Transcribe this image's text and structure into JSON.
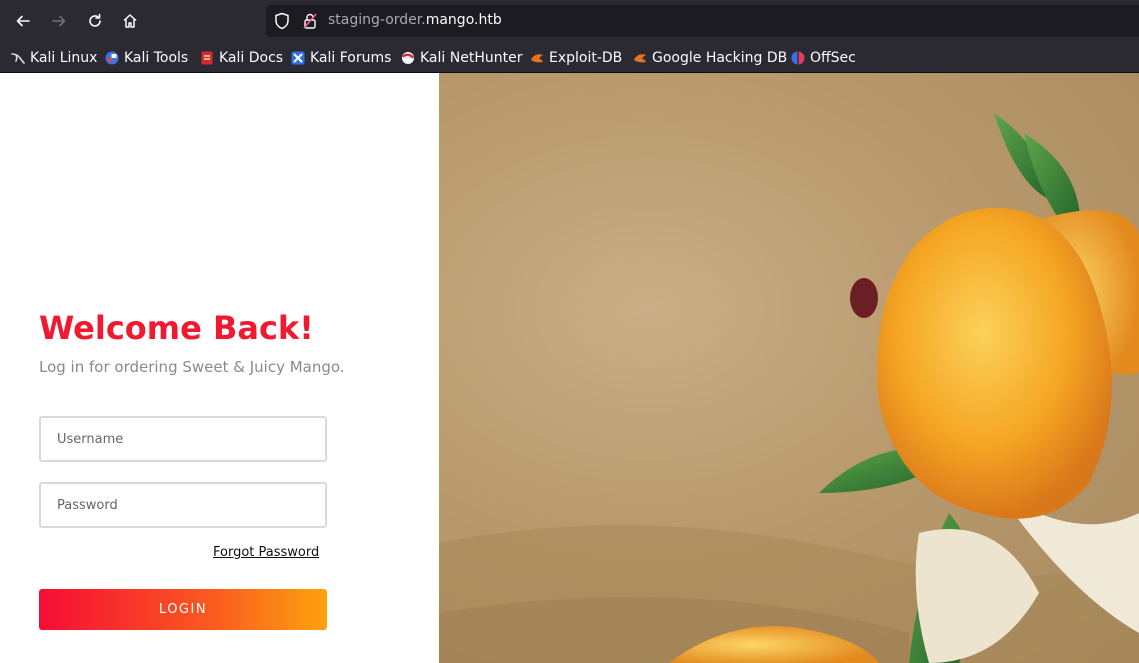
{
  "browser": {
    "url_subdomain": "staging-order.",
    "url_domain": "mango.htb",
    "bookmarks": [
      {
        "label": "Kali Linux",
        "icon": "kali-dragon-icon"
      },
      {
        "label": "Kali Tools",
        "icon": "kali-tools-icon"
      },
      {
        "label": "Kali Docs",
        "icon": "kali-docs-icon"
      },
      {
        "label": "Kali Forums",
        "icon": "kali-forums-icon"
      },
      {
        "label": "Kali NetHunter",
        "icon": "kali-nethunter-icon"
      },
      {
        "label": "Exploit-DB",
        "icon": "exploit-db-icon"
      },
      {
        "label": "Google Hacking DB",
        "icon": "google-hacking-db-icon"
      },
      {
        "label": "OffSec",
        "icon": "offsec-icon"
      }
    ]
  },
  "login": {
    "heading": "Welcome Back!",
    "subtitle": "Log in for ordering Sweet & Juicy Mango.",
    "username_placeholder": "Username",
    "password_placeholder": "Password",
    "forgot_label": "Forgot Password",
    "login_label": "LOGIN"
  },
  "colors": {
    "accent": "#f0192f",
    "button_start": "#f50d35",
    "button_end": "#fda20d",
    "chrome": "#2b2a33"
  }
}
